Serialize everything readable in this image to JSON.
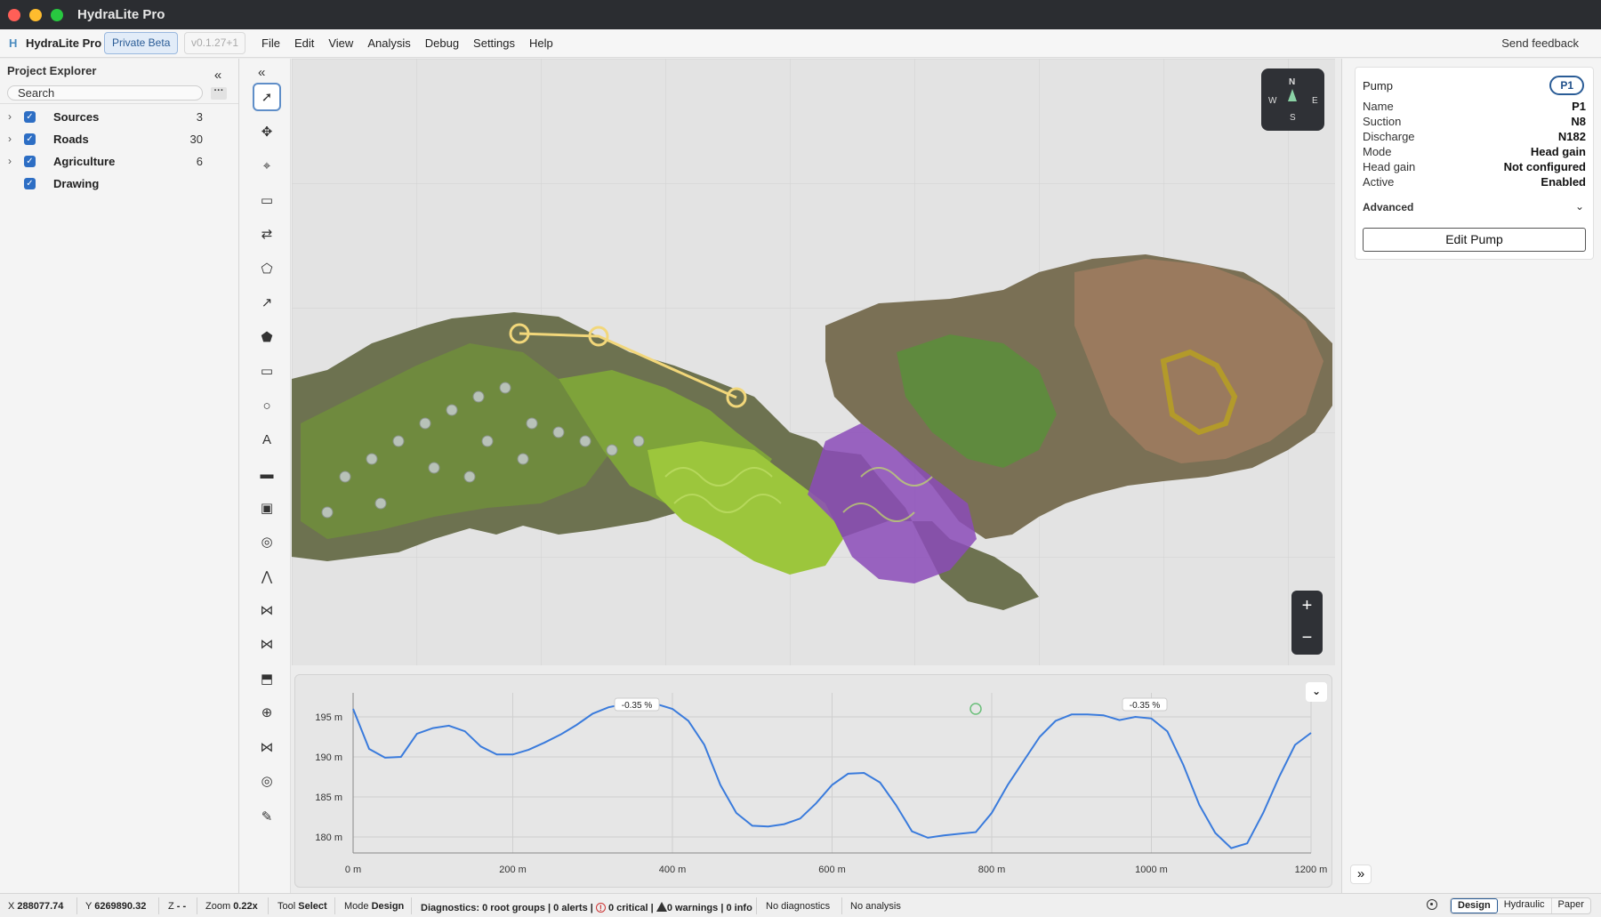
{
  "window": {
    "title": "HydraLite Pro"
  },
  "menubar": {
    "logo": "H",
    "app_name": "HydraLite Pro",
    "beta_label": "Private Beta",
    "version": "v0.1.27+1",
    "menus": [
      "File",
      "Edit",
      "View",
      "Analysis",
      "Debug",
      "Settings",
      "Help"
    ],
    "feedback": "Send feedback"
  },
  "explorer": {
    "title": "Project Explorer",
    "search_placeholder": "Search",
    "layers": [
      {
        "label": "Sources",
        "count": "3",
        "expandable": true
      },
      {
        "label": "Roads",
        "count": "30",
        "expandable": true
      },
      {
        "label": "Agriculture",
        "count": "6",
        "expandable": true
      },
      {
        "label": "Drawing",
        "count": "",
        "expandable": false
      }
    ]
  },
  "tools": [
    "select-tool-icon",
    "move-tool-icon",
    "node-tool-icon",
    "tank-tool-icon",
    "pipe-route-tool-icon",
    "shape-tool-icon",
    "curve-tool-icon",
    "polygon-tool-icon",
    "rectangle-tool-icon",
    "circle-tool-icon",
    "text-tool-icon",
    "measure-tool-icon",
    "image-tool-icon",
    "target-tool-icon",
    "road-tool-icon",
    "valve-tool-icon",
    "check-valve-tool-icon",
    "pump-tool-icon",
    "fitting-tool-icon",
    "sprinkler-tool-icon",
    "emitter-tool-icon",
    "eraser-tool-icon"
  ],
  "map": {
    "compass": {
      "n": "N",
      "s": "S",
      "e": "E",
      "w": "W"
    },
    "zoom_in": "+",
    "zoom_out": "−"
  },
  "profile": {
    "y_ticks": [
      "195 m",
      "190 m",
      "185 m",
      "180 m"
    ],
    "x_ticks": [
      "0 m",
      "200 m",
      "400 m",
      "600 m",
      "800 m",
      "1000 m",
      "1200 m"
    ],
    "slope_labels": [
      "-0.35 %",
      "-0.35 %"
    ]
  },
  "chart_data": {
    "type": "line",
    "x": [
      0,
      20,
      40,
      60,
      80,
      100,
      120,
      140,
      160,
      180,
      200,
      220,
      240,
      260,
      280,
      300,
      320,
      340,
      360,
      380,
      400,
      420,
      440,
      460,
      480,
      500,
      520,
      540,
      560,
      580,
      600,
      620,
      640,
      660,
      680,
      700,
      720,
      740,
      760,
      780,
      800,
      820,
      840,
      860,
      880,
      900,
      920,
      940,
      960,
      980,
      1000,
      1020,
      1040,
      1060,
      1080,
      1100,
      1120,
      1140,
      1160,
      1180,
      1200
    ],
    "series": [
      {
        "values": [
          196.0,
          191.0,
          189.9,
          190.0,
          192.9,
          193.6,
          193.9,
          193.2,
          191.3,
          190.3,
          190.3,
          190.9,
          191.8,
          192.8,
          194.0,
          195.4,
          196.2,
          196.6,
          197.0,
          196.6,
          196.0,
          194.5,
          191.5,
          186.5,
          183.0,
          181.4,
          181.3,
          181.6,
          182.3,
          184.2,
          186.5,
          187.9,
          188.0,
          186.8,
          184.0,
          180.7,
          179.9,
          180.2,
          180.4,
          180.6,
          183.0,
          186.5,
          189.5,
          192.5,
          194.5,
          195.3,
          195.3,
          195.2,
          194.6,
          195.0,
          194.8,
          193.2,
          189.0,
          184.0,
          180.5,
          178.6,
          179.2,
          183.0,
          187.5,
          191.5,
          193.0
        ]
      }
    ],
    "xlabel": "",
    "ylabel": "",
    "xlim": [
      0,
      1200
    ],
    "ylim": [
      178,
      198
    ],
    "grid": true
  },
  "properties": {
    "title": "Pump",
    "id": "P1",
    "rows": [
      {
        "key": "Name",
        "value": "P1"
      },
      {
        "key": "Suction",
        "value": "N8"
      },
      {
        "key": "Discharge",
        "value": "N182"
      },
      {
        "key": "Mode",
        "value": "Head gain"
      },
      {
        "key": "Head gain",
        "value": "Not configured"
      },
      {
        "key": "Active",
        "value": "Enabled"
      }
    ],
    "advanced_label": "Advanced",
    "edit_button": "Edit Pump",
    "expand": "»"
  },
  "status": {
    "x_label": "X",
    "x_value": "288077.74",
    "y_label": "Y",
    "y_value": "6269890.32",
    "z_label": "Z",
    "z_value": "- -",
    "zoom_label": "Zoom",
    "zoom_value": "0.22x",
    "tool_label": "Tool",
    "tool_value": "Select",
    "mode_label": "Mode",
    "mode_value": "Design",
    "diag_label": "Diagnostics:",
    "diag_groups": "0 root groups",
    "diag_alerts": "0 alerts",
    "diag_critical": "0 critical",
    "diag_warnings": "0 warnings",
    "diag_info": "0 info",
    "no_diagnostics": "No diagnostics",
    "no_analysis": "No analysis",
    "modes": [
      "Design",
      "Hydraulic",
      "Paper"
    ]
  },
  "colors": {
    "accent": "#2d6ec4",
    "profile_line": "#3a7bdc",
    "pipe_highlight": "#f2d77a",
    "zone_purple": "#8b4bb8",
    "zone_green": "#8ac23b"
  }
}
